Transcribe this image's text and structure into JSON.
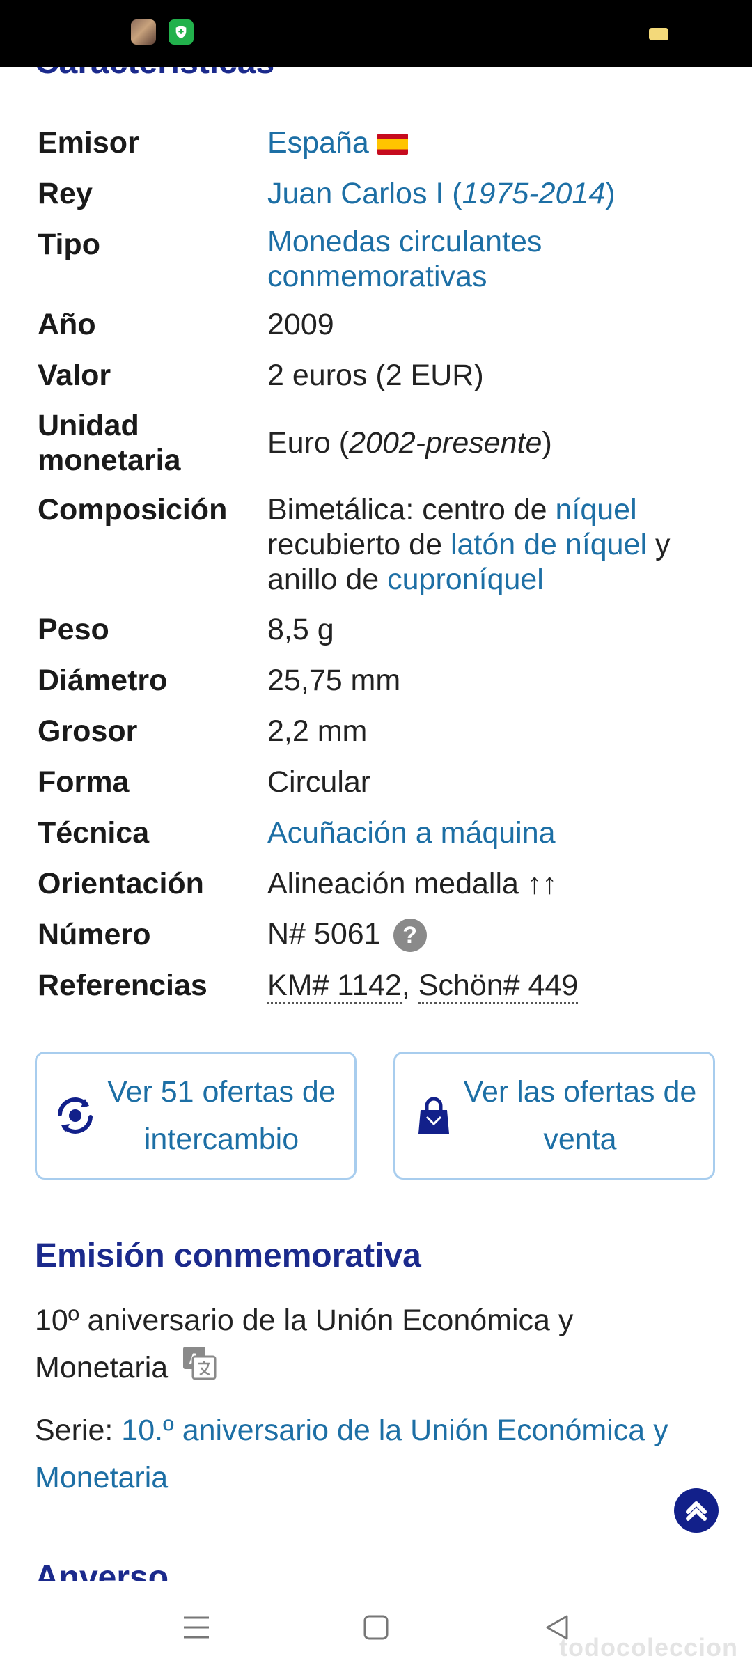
{
  "colors": {
    "heading": "#1b2a8c",
    "link": "#1d6fa5",
    "button_border": "#a8cdee",
    "status_bar": "#000000"
  },
  "sections": {
    "characteristics_title": "Características",
    "emission_title": "Emisión conmemorativa",
    "obverse_title": "Anverso"
  },
  "specs": {
    "emisor": {
      "label": "Emisor",
      "value": "España",
      "icon": "spain-flag-icon"
    },
    "rey": {
      "label": "Rey",
      "value": "Juan Carlos I",
      "paren_open": " (",
      "years": "1975-2014",
      "paren_close": ")"
    },
    "tipo": {
      "label": "Tipo",
      "value_line1": "Monedas circulantes",
      "value_line2": "conmemorativas"
    },
    "ano": {
      "label": "Año",
      "value": "2009"
    },
    "valor": {
      "label": "Valor",
      "value": "2 euros (2 EUR)"
    },
    "unidad": {
      "label_line1": "Unidad",
      "label_line2": "monetaria",
      "value": "Euro (",
      "period": "2002-presente",
      "close": ")"
    },
    "composicion": {
      "label": "Composición",
      "part1": "Bimetálica: centro de ",
      "link1": "níquel",
      "part2": "recubierto de ",
      "link2": "latón de níquel",
      "part3": " y",
      "part4": "anillo de ",
      "link3": "cuproníquel"
    },
    "peso": {
      "label": "Peso",
      "value": "8,5 g"
    },
    "diametro": {
      "label": "Diámetro",
      "value": "25,75 mm"
    },
    "grosor": {
      "label": "Grosor",
      "value": "2,2 mm"
    },
    "forma": {
      "label": "Forma",
      "value": "Circular"
    },
    "tecnica": {
      "label": "Técnica",
      "value": "Acuñación a máquina"
    },
    "orientacion": {
      "label": "Orientación",
      "value": "Alineación medalla ↑↑"
    },
    "numero": {
      "label": "Número",
      "value": "N# 5061",
      "icon": "help-icon",
      "icon_text": "?"
    },
    "referencias": {
      "label": "Referencias",
      "ref1": "KM# 1142",
      "sep": ", ",
      "ref2": "Schön# 449"
    }
  },
  "buttons": {
    "exchange": {
      "line1": "Ver 51 ofertas de",
      "line2": "intercambio",
      "icon": "exchange-icon"
    },
    "sale": {
      "line1": "Ver las ofertas de",
      "line2": "venta",
      "icon": "shopping-bag-icon"
    }
  },
  "emission": {
    "description_line1": "10º aniversario de la Unión Económica y",
    "description_line2": "Monetaria",
    "translate_icon": "translate-icon",
    "serie_label": "Serie: ",
    "serie_link_line1": "10.º aniversario de la Unión Económica y",
    "serie_link_line2": "Monetaria"
  },
  "watermark": "todocoleccion",
  "nav": {
    "icons": [
      "menu-icon",
      "home-square-icon",
      "back-triangle-icon"
    ]
  }
}
